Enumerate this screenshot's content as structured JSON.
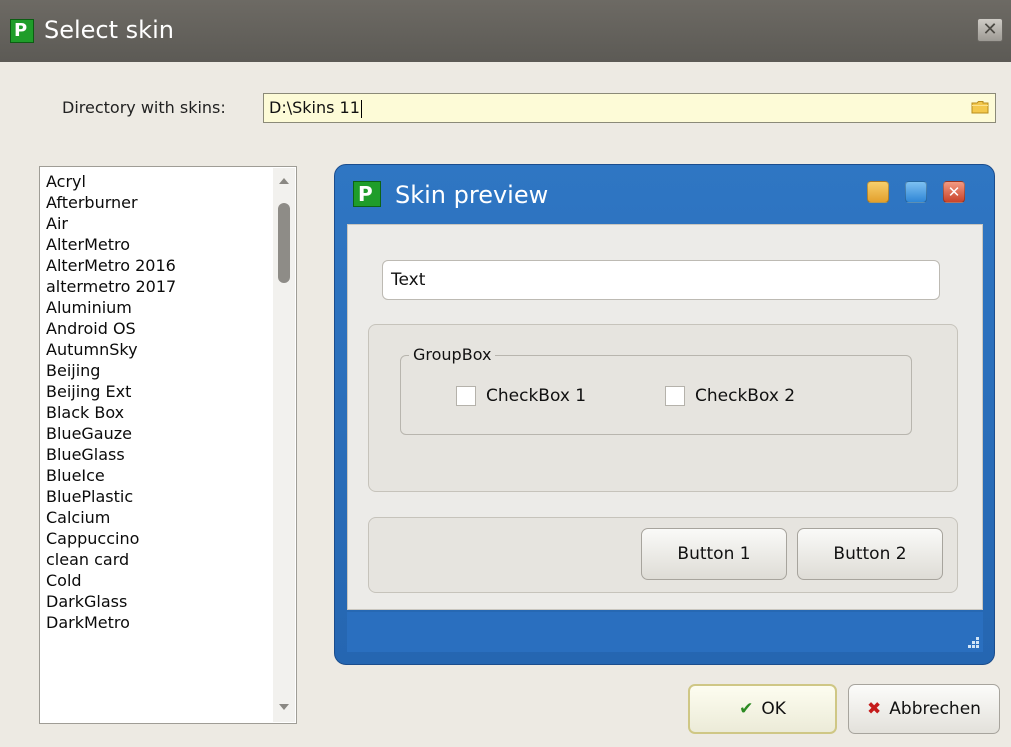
{
  "window": {
    "title": "Select skin",
    "close_glyph": "✕",
    "app_icon": "p-logo-icon",
    "app_icon_glyph": "P"
  },
  "directory": {
    "label": "Directory with skins:",
    "value": "D:\\Skins 11",
    "browse_icon": "folder-icon"
  },
  "skin_list": {
    "items": [
      "Acryl",
      "Afterburner",
      "Air",
      "AlterMetro",
      "AlterMetro 2016",
      "altermetro 2017",
      "Aluminium",
      "Android OS",
      "AutumnSky",
      "Beijing",
      "Beijing Ext",
      "Black Box",
      "BlueGauze",
      "BlueGlass",
      "BlueIce",
      "BluePlastic",
      "Calcium",
      "Cappuccino",
      "clean card",
      "Cold",
      "DarkGlass",
      "DarkMetro"
    ],
    "scroll_position": 0.05
  },
  "preview": {
    "title": "Skin preview",
    "logo_glyph": "P",
    "close_glyph": "✕",
    "text_value": "Text",
    "groupbox_label": "GroupBox",
    "checkbox1": "CheckBox 1",
    "checkbox2": "CheckBox 2",
    "checkbox1_checked": false,
    "checkbox2_checked": false,
    "button1": "Button 1",
    "button2": "Button 2"
  },
  "dialog_buttons": {
    "ok": "OK",
    "ok_icon": "checkmark-icon",
    "ok_glyph": "✔",
    "cancel": "Abbrechen",
    "cancel_icon": "x-icon",
    "cancel_glyph": "✖"
  },
  "colors": {
    "title_bar": "#5f5c57",
    "preview_frame": "#2c6fbe",
    "directory_input_bg": "#fdfbd7",
    "ok_icon": "#2c8a22",
    "cancel_icon": "#c51b1b"
  }
}
